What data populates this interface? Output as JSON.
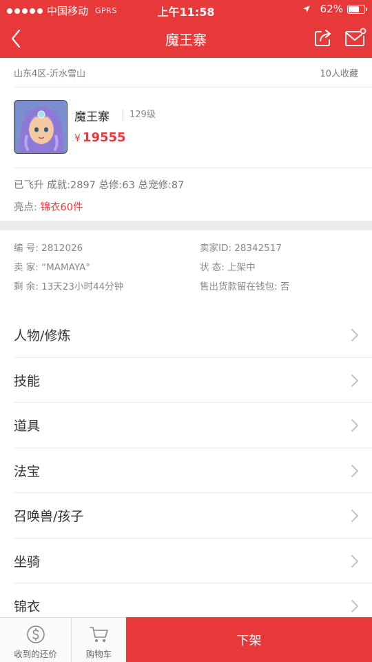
{
  "status_bar": {
    "carrier": "中国移动",
    "network": "GPRS",
    "time": "上午11:58",
    "battery": "62%"
  },
  "header": {
    "title": "魔王寨",
    "back_icon": "chevron-left-icon",
    "share_icon": "share-icon",
    "message_icon": "mail-icon"
  },
  "listing": {
    "server": "山东4区-沂水雪山",
    "favorites": "10人收藏",
    "role_name": "魔王寨",
    "level": "129级",
    "currency": "¥",
    "price": "19555",
    "stats": "已飞升 成就:2897 总修:63 总宠修:87",
    "highlight_label": "亮点:",
    "highlight_value": "锦衣60件"
  },
  "info": {
    "id": "编  号: 2812026",
    "seller_id": "卖家ID: 28342517",
    "seller": "卖  家: “MAMAYA°",
    "status": "状  态: 上架中",
    "remaining": "剩  余: 13天23小时44分钟",
    "wallet": "售出货款留在钱包: 否"
  },
  "menu": [
    {
      "label": "人物/修炼"
    },
    {
      "label": "技能"
    },
    {
      "label": "道具"
    },
    {
      "label": "法宝"
    },
    {
      "label": "召唤兽/孩子"
    },
    {
      "label": "坐骑"
    },
    {
      "label": "锦衣"
    }
  ],
  "bottom_bar": {
    "offers_label": "收到的还价",
    "cart_label": "购物车",
    "delist_label": "下架"
  },
  "colors": {
    "accent": "#e8393a",
    "background_band": "#ebebeb"
  }
}
